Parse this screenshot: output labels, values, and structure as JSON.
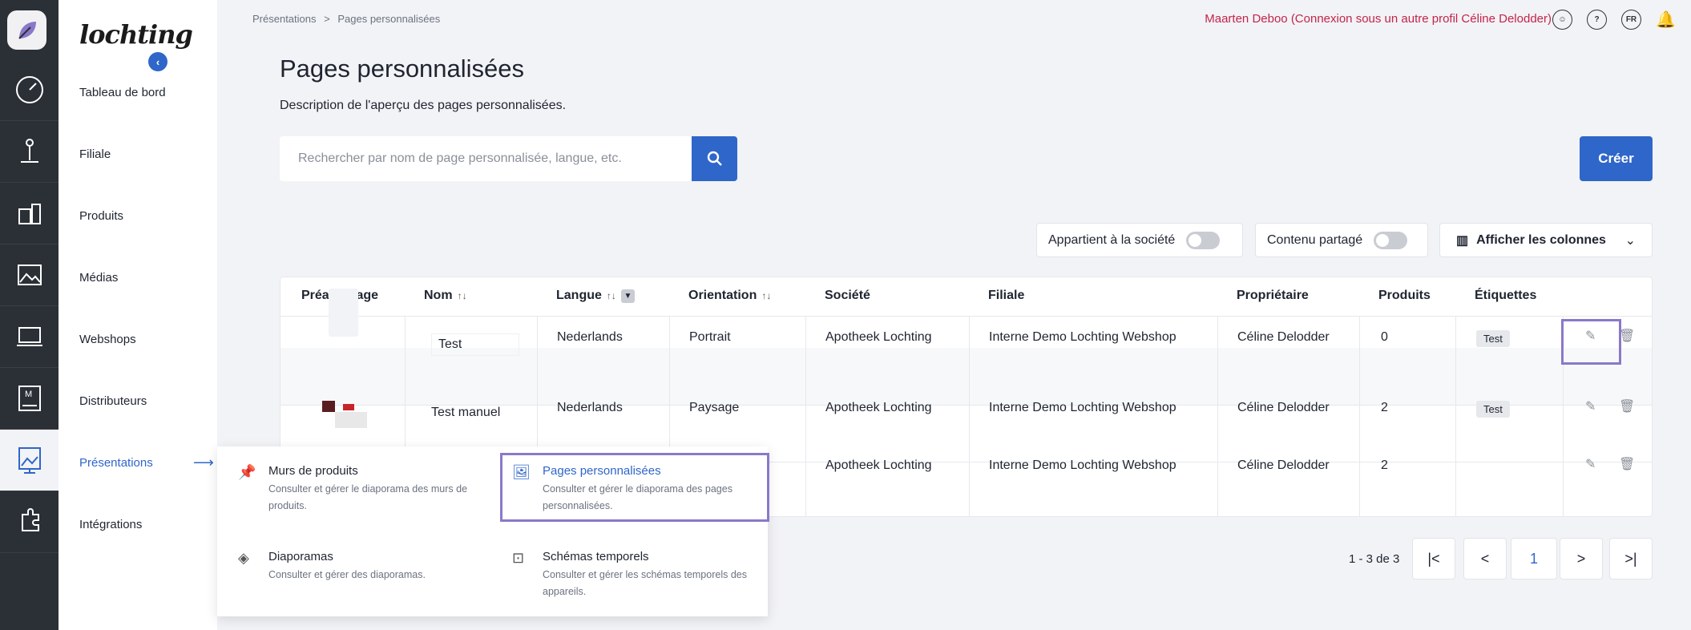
{
  "rail": {
    "icons": [
      "logo-leaf-icon",
      "dashboard-icon",
      "store-icon",
      "products-icon",
      "media-icon",
      "webshop-icon",
      "distributor-icon",
      "presentation-icon",
      "integration-icon"
    ]
  },
  "brand": "lochting",
  "menu": {
    "items": [
      {
        "label": "Tableau de bord"
      },
      {
        "label": "Filiale"
      },
      {
        "label": "Produits"
      },
      {
        "label": "Médias"
      },
      {
        "label": "Webshops"
      },
      {
        "label": "Distributeurs"
      },
      {
        "label": "Présentations",
        "active": true
      },
      {
        "label": "Intégrations"
      }
    ]
  },
  "breadcrumb": {
    "root": "Présentations",
    "sep": ">",
    "current": "Pages personnalisées"
  },
  "header": {
    "user": "Maarten Deboo (Connexion sous un autre profil Céline Delodder)",
    "lang": "FR",
    "help": "?"
  },
  "page": {
    "title": "Pages personnalisées",
    "description": "Description de l'aperçu des pages personnalisées."
  },
  "search": {
    "placeholder": "Rechercher par nom de page personnalisée, langue, etc."
  },
  "create_label": "Créer",
  "toggles": {
    "company": "Appartient à la société",
    "shared": "Contenu partagé",
    "columns": "Afficher les colonnes"
  },
  "table": {
    "headers": [
      "Préaffichage",
      "Nom",
      "Langue",
      "Orientation",
      "Société",
      "Filiale",
      "Propriétaire",
      "Produits",
      "Étiquettes"
    ],
    "rows": [
      {
        "name": "Test",
        "lang": "Nederlands",
        "orient": "Portrait",
        "company": "Apotheek Lochting",
        "branch": "Interne Demo Lochting Webshop",
        "owner": "Céline Delodder",
        "products": "0",
        "tag": "Test"
      },
      {
        "name": "Test manuel",
        "lang": "Nederlands",
        "orient": "Paysage",
        "company": "Apotheek Lochting",
        "branch": "Interne Demo Lochting Webshop",
        "owner": "Céline Delodder",
        "products": "2",
        "tag": "Test"
      },
      {
        "name": "",
        "lang": "",
        "orient": "",
        "company": "Apotheek Lochting",
        "branch": "Interne Demo Lochting Webshop",
        "owner": "Céline Delodder",
        "products": "2",
        "tag": ""
      }
    ]
  },
  "pagination": {
    "info": "1 - 3 de 3",
    "current": "1",
    "first": "|<",
    "prev": "<",
    "next": ">",
    "last": ">|"
  },
  "dropdown": {
    "items": [
      {
        "title": "Murs de produits",
        "sub": "Consulter et gérer le diaporama des murs de produits."
      },
      {
        "title": "Pages personnalisées",
        "sub": "Consulter et gérer le diaporama des pages personnalisées.",
        "selected": true
      },
      {
        "title": "Diaporamas",
        "sub": "Consulter et gérer des diaporamas."
      },
      {
        "title": "Schémas temporels",
        "sub": "Consulter et gérer les schémas temporels des appareils."
      }
    ]
  },
  "colors": {
    "accent": "#2f66c9",
    "user": "#c3244b",
    "highlight": "#8b78c9"
  }
}
